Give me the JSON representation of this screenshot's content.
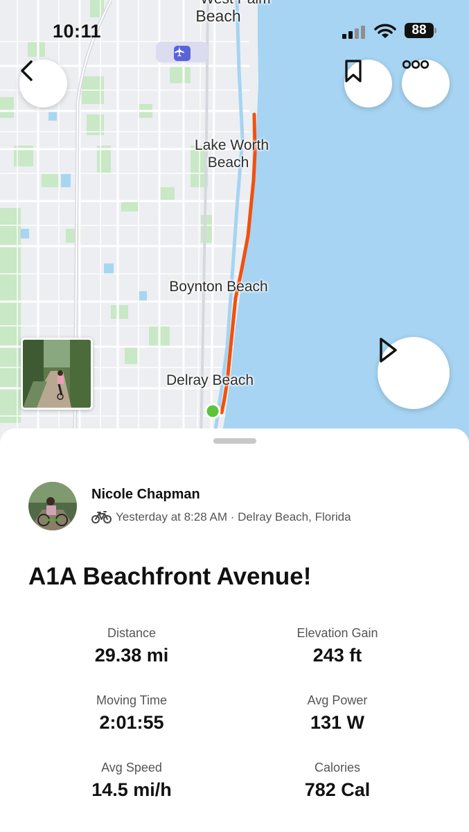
{
  "status_bar": {
    "time": "10:11",
    "battery": "88"
  },
  "map": {
    "labels": {
      "west_palm_top": "West Palm",
      "west_palm_bottom": "Beach",
      "lake_worth_top": "Lake Worth",
      "lake_worth_bottom": "Beach",
      "boynton": "Boynton Beach",
      "delray": "Delray Beach"
    },
    "colors": {
      "route": "#f2500e",
      "water": "#a6d4f2",
      "start": "#5cc43c"
    }
  },
  "activity": {
    "athlete": "Nicole Chapman",
    "meta": "Yesterday at 8:28 AM · Delray Beach, Florida",
    "title": "A1A Beachfront Avenue!",
    "stats": [
      {
        "label": "Distance",
        "value": "29.38 mi"
      },
      {
        "label": "Elevation Gain",
        "value": "243 ft"
      },
      {
        "label": "Moving Time",
        "value": "2:01:55"
      },
      {
        "label": "Avg Power",
        "value": "131 W"
      },
      {
        "label": "Avg Speed",
        "value": "14.5 mi/h"
      },
      {
        "label": "Calories",
        "value": "782 Cal"
      }
    ]
  },
  "icons": [
    "back-chevron-icon",
    "bookmark-icon",
    "more-dots-icon",
    "play-icon",
    "airport-icon",
    "bike-icon",
    "signal-icon",
    "wifi-icon",
    "battery-icon"
  ]
}
